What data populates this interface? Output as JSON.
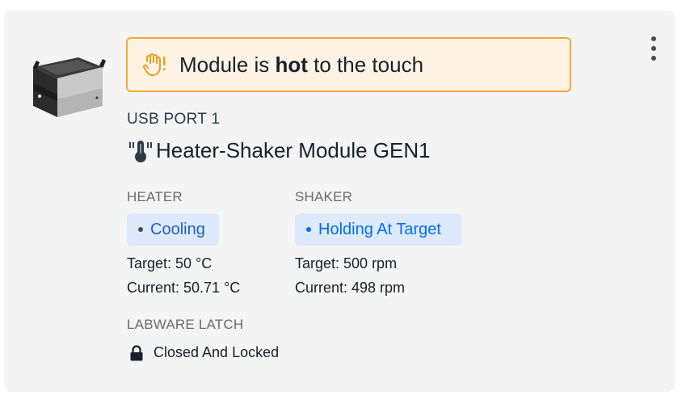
{
  "alert": {
    "prefix": "Module is ",
    "bold": "hot",
    "suffix": " to the touch",
    "icon": "hot-hand-warning-icon",
    "border_color": "#f2a938",
    "background_color": "#fff4e3"
  },
  "module": {
    "port": "USB PORT 1",
    "name": "Heater-Shaker Module GEN1",
    "icon": "thermometer-icon",
    "image": "heater-shaker-module-image"
  },
  "heater": {
    "section_label": "HEATER",
    "status": "Cooling",
    "target": "Target: 50 °C",
    "current": "Current: 50.71 °C"
  },
  "shaker": {
    "section_label": "SHAKER",
    "status": "Holding At Target",
    "target": "Target: 500 rpm",
    "current": "Current: 498 rpm"
  },
  "latch": {
    "section_label": "LABWARE LATCH",
    "status": "Closed And Locked",
    "icon": "lock-icon"
  },
  "menu": {
    "icon": "overflow-menu-icon"
  },
  "colors": {
    "card_background": "#f4f4f4",
    "pill_background": "#deeafb",
    "accent_blue": "#006cfa",
    "warning_orange": "#f2a938"
  }
}
